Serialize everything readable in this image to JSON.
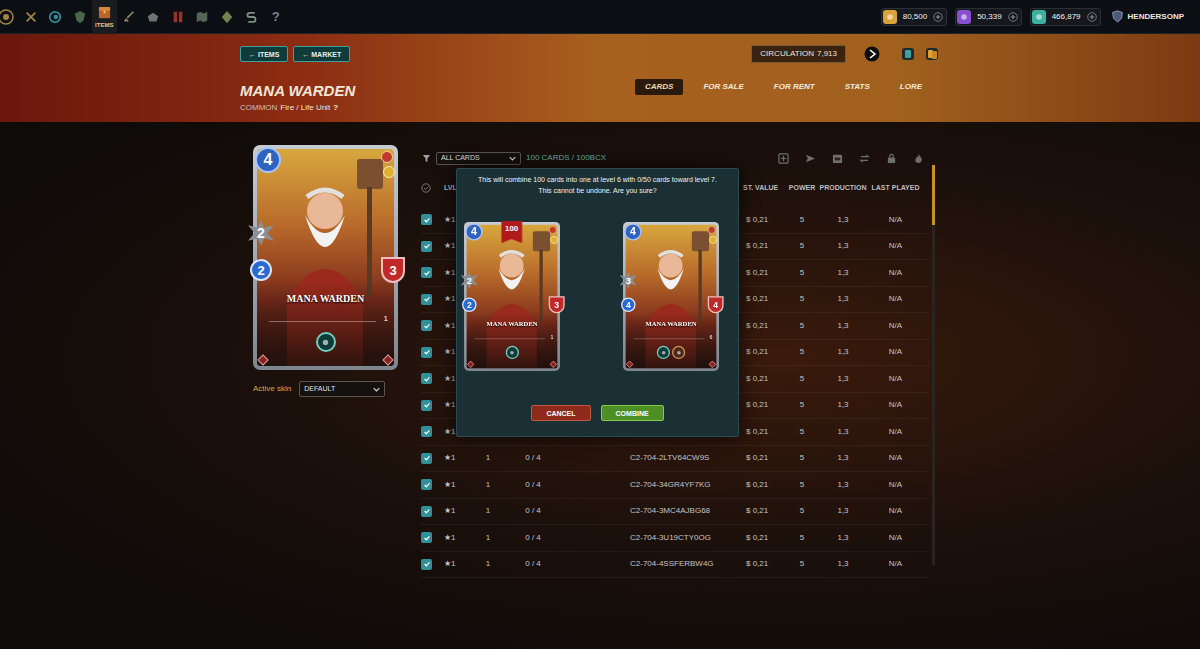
{
  "nav": {
    "items": [
      {
        "kind": "logo",
        "selected": false
      },
      {
        "kind": "battle",
        "selected": false
      },
      {
        "kind": "swirl",
        "selected": false
      },
      {
        "kind": "guild",
        "selected": false
      },
      {
        "kind": "items",
        "label": "ITEMS",
        "selected": true
      },
      {
        "kind": "sword",
        "selected": false
      },
      {
        "kind": "chest",
        "selected": false
      },
      {
        "kind": "banner",
        "selected": false
      },
      {
        "kind": "map",
        "selected": false
      },
      {
        "kind": "diamond",
        "selected": false
      },
      {
        "kind": "sps",
        "selected": false
      },
      {
        "kind": "help",
        "label": "?",
        "selected": false
      }
    ],
    "currencies": [
      {
        "value": "80,500",
        "color": "#d9a23a"
      },
      {
        "value": "50,339",
        "color": "#8a4fd0"
      },
      {
        "value": "466,879",
        "color": "#3fb0a0"
      }
    ],
    "user": {
      "name": "HENDERSONP"
    }
  },
  "header": {
    "back_buttons": [
      {
        "label": "← ITEMS"
      },
      {
        "label": "← MARKET"
      }
    ],
    "title": "MANA WARDEN",
    "rarity": "COMMON",
    "type": "Fire / Life Unit",
    "help": "?",
    "circulation_label": "CIRCULATION",
    "circulation": "7,913",
    "tabs": [
      {
        "label": "CARDS",
        "selected": true
      },
      {
        "label": "FOR SALE",
        "selected": false
      },
      {
        "label": "FOR RENT",
        "selected": false
      },
      {
        "label": "STATS",
        "selected": false
      },
      {
        "label": "LORE",
        "selected": false
      }
    ]
  },
  "card": {
    "mana": "4",
    "attack": "2",
    "speed": "2",
    "health": "3",
    "name": "MANA WARDEN",
    "level": "1",
    "abilities": [
      {
        "kind": "magic"
      }
    ]
  },
  "skin": {
    "label": "Active skin",
    "value": "DEFAULT"
  },
  "filter": {
    "value": "ALL CARDS",
    "count": "100 CARDS / 100BCX"
  },
  "table": {
    "columns": [
      "LVL",
      "ST. VALUE",
      "POWER",
      "PRODUCTION",
      "LAST PLAYED"
    ],
    "rows": [
      {
        "checked": true,
        "rank": "★1",
        "value": "$ 0,21",
        "power": "5",
        "production": "1,3",
        "last_played": "N/A"
      },
      {
        "checked": true,
        "rank": "★1",
        "value": "$ 0,21",
        "power": "5",
        "production": "1,3",
        "last_played": "N/A"
      },
      {
        "checked": true,
        "rank": "★1",
        "value": "$ 0,21",
        "power": "5",
        "production": "1,3",
        "last_played": "N/A"
      },
      {
        "checked": true,
        "rank": "★1",
        "value": "$ 0,21",
        "power": "5",
        "production": "1,3",
        "last_played": "N/A"
      },
      {
        "checked": true,
        "rank": "★1",
        "value": "$ 0,21",
        "power": "5",
        "production": "1,3",
        "last_played": "N/A"
      },
      {
        "checked": true,
        "rank": "★1",
        "value": "$ 0,21",
        "power": "5",
        "production": "1,3",
        "last_played": "N/A"
      },
      {
        "checked": true,
        "rank": "★1",
        "value": "$ 0,21",
        "power": "5",
        "production": "1,3",
        "last_played": "N/A"
      },
      {
        "checked": true,
        "rank": "★1",
        "value": "$ 0,21",
        "power": "5",
        "production": "1,3",
        "last_played": "N/A"
      },
      {
        "checked": true,
        "rank": "★1",
        "value": "$ 0,21",
        "power": "5",
        "production": "1,3",
        "last_played": "N/A"
      },
      {
        "checked": true,
        "rank": "★1",
        "lvl": "1",
        "xp": "0 / 4",
        "uid": "C2-704-2LTV64CW9S",
        "value": "$ 0,21",
        "power": "5",
        "production": "1,3",
        "last_played": "N/A"
      },
      {
        "checked": true,
        "rank": "★1",
        "lvl": "1",
        "xp": "0 / 4",
        "uid": "C2-704-34GR4YF7KG",
        "value": "$ 0,21",
        "power": "5",
        "production": "1,3",
        "last_played": "N/A"
      },
      {
        "checked": true,
        "rank": "★1",
        "lvl": "1",
        "xp": "0 / 4",
        "uid": "C2-704-3MC4AJBG68",
        "value": "$ 0,21",
        "power": "5",
        "production": "1,3",
        "last_played": "N/A"
      },
      {
        "checked": true,
        "rank": "★1",
        "lvl": "1",
        "xp": "0 / 4",
        "uid": "C2-704-3U19CTY0OG",
        "value": "$ 0,21",
        "power": "5",
        "production": "1,3",
        "last_played": "N/A"
      },
      {
        "checked": true,
        "rank": "★1",
        "lvl": "1",
        "xp": "0 / 4",
        "uid": "C2-704-4SSFERBW4G",
        "value": "$ 0,21",
        "power": "5",
        "production": "1,3",
        "last_played": "N/A"
      }
    ]
  },
  "modal": {
    "lines": [
      "This will combine 100 cards into one at level 6 with 0/50 cards toward level 7.",
      "This cannot be undone. Are you sure?"
    ],
    "cards": [
      {
        "mana": "4",
        "attack": "2",
        "speed": "2",
        "health": "3",
        "name": "MANA WARDEN",
        "level": "1",
        "badge": "100",
        "abilities": [
          {
            "kind": "magic"
          }
        ]
      },
      {
        "mana": "4",
        "attack": "3",
        "speed": "4",
        "health": "4",
        "name": "MANA WARDEN",
        "level": "6",
        "abilities": [
          {
            "kind": "magic"
          },
          {
            "kind": "armor"
          }
        ]
      }
    ],
    "buttons": [
      {
        "label": "CANCEL",
        "kind": "cancel"
      },
      {
        "label": "COMBINE",
        "kind": "confirm"
      }
    ]
  }
}
